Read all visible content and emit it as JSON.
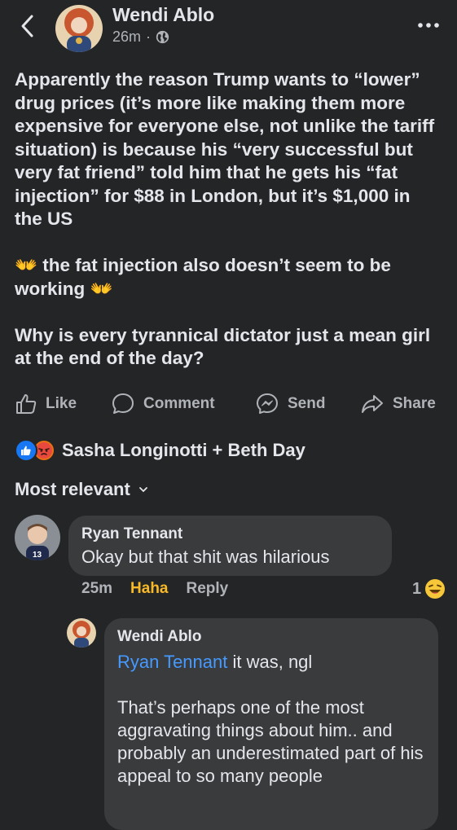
{
  "header": {
    "author": "Wendi Ablo",
    "time": "26m",
    "audience_icon": "globe-icon",
    "back_icon": "chevron-left-icon",
    "more_icon": "more-icon"
  },
  "post": {
    "paragraphs": [
      "Apparently the reason Trump wants to “lower” drug prices (it’s more like making them more expensive for everyone else, not unlike the tariff situation) is because his “very successful but very fat friend” told him that he gets his “fat injection” for $88 in London, but it’s $1,000 in the US",
      "👐 the fat injection also doesn’t seem to be working 👐",
      "Why is every tyrannical dictator just a mean girl at the end of the day?"
    ]
  },
  "actions": {
    "like": "Like",
    "comment": "Comment",
    "send": "Send",
    "share": "Share"
  },
  "reactions": {
    "summary": "Sasha Longinotti + Beth Day",
    "types": [
      "like",
      "angry"
    ]
  },
  "comments": {
    "sort_label": "Most relevant",
    "first": {
      "author": "Ryan Tennant",
      "text": "Okay but that shit was hilarious",
      "time": "25m",
      "reaction_label": "Haha",
      "reply_label": "Reply",
      "reaction_count": "1",
      "reaction_emoji": "😜"
    },
    "reply": {
      "author": "Wendi Ablo",
      "mention": "Ryan Tennant",
      "text_after_mention": " it was, ngl",
      "paragraph2": "That’s perhaps one of the most aggravating things about him.. and probably an underestimated part of his appeal to so many people"
    }
  },
  "colors": {
    "background": "#242526",
    "bubble": "#3a3b3c",
    "text": "#e4e6eb",
    "secondary": "#b0b3b8",
    "link": "#4599ff",
    "haha": "#f7b928"
  }
}
